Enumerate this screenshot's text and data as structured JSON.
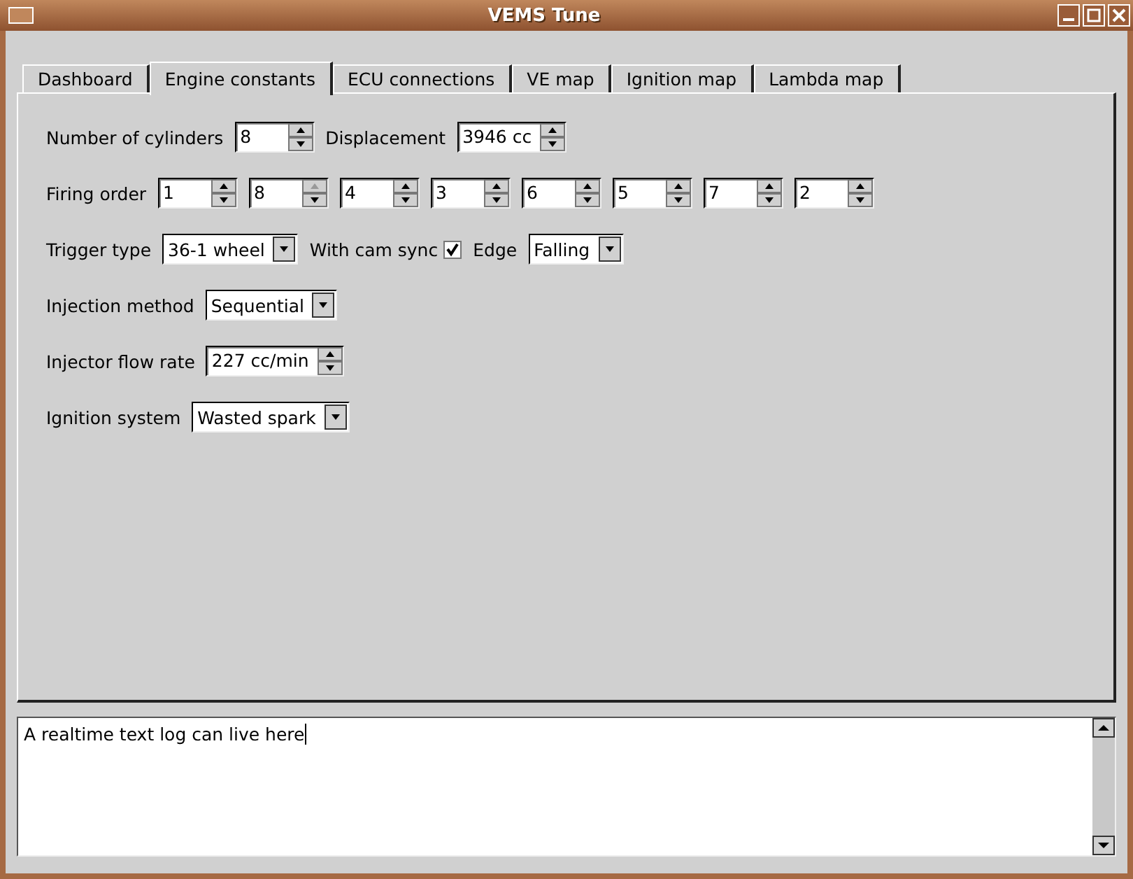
{
  "window": {
    "title": "VEMS Tune"
  },
  "tabs": [
    {
      "label": "Dashboard",
      "selected": false
    },
    {
      "label": "Engine constants",
      "selected": true
    },
    {
      "label": "ECU connections",
      "selected": false
    },
    {
      "label": "VE map",
      "selected": false
    },
    {
      "label": "Ignition map",
      "selected": false
    },
    {
      "label": "Lambda map",
      "selected": false
    }
  ],
  "form_rows": [
    {
      "items": [
        {
          "kind": "label",
          "text": "Number of cylinders"
        },
        {
          "kind": "spin",
          "value": "8",
          "up_disabled": false
        },
        {
          "kind": "label",
          "text": "Displacement"
        },
        {
          "kind": "spin",
          "value": "3946 cc",
          "up_disabled": false
        }
      ]
    },
    {
      "items": [
        {
          "kind": "label",
          "text": "Firing order"
        },
        {
          "kind": "spin",
          "value": "1",
          "up_disabled": false
        },
        {
          "kind": "spin",
          "value": "8",
          "up_disabled": true
        },
        {
          "kind": "spin",
          "value": "4",
          "up_disabled": false
        },
        {
          "kind": "spin",
          "value": "3",
          "up_disabled": false
        },
        {
          "kind": "spin",
          "value": "6",
          "up_disabled": false
        },
        {
          "kind": "spin",
          "value": "5",
          "up_disabled": false
        },
        {
          "kind": "spin",
          "value": "7",
          "up_disabled": false
        },
        {
          "kind": "spin",
          "value": "2",
          "up_disabled": false
        }
      ]
    },
    {
      "items": [
        {
          "kind": "label",
          "text": "Trigger type"
        },
        {
          "kind": "combo",
          "value": "36-1 wheel"
        },
        {
          "kind": "check",
          "label": "With cam sync",
          "checked": true
        },
        {
          "kind": "label",
          "text": "Edge"
        },
        {
          "kind": "combo",
          "value": "Falling"
        }
      ]
    },
    {
      "items": [
        {
          "kind": "label",
          "text": "Injection method"
        },
        {
          "kind": "combo",
          "value": "Sequential"
        }
      ]
    },
    {
      "items": [
        {
          "kind": "label",
          "text": "Injector flow rate"
        },
        {
          "kind": "spin",
          "value": "227 cc/min",
          "up_disabled": false
        }
      ]
    },
    {
      "items": [
        {
          "kind": "label",
          "text": "Ignition system"
        },
        {
          "kind": "combo",
          "value": "Wasted spark"
        }
      ]
    }
  ],
  "log": {
    "text": "A realtime text log can live here"
  }
}
